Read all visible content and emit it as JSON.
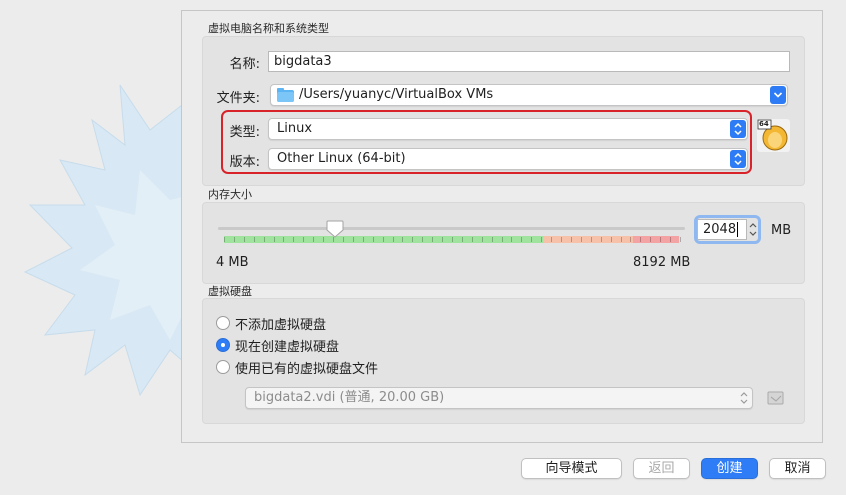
{
  "name_type_group": {
    "title": "虚拟电脑名称和系统类型",
    "name_label": "名称:",
    "name_value": "bigdata3",
    "folder_label": "文件夹:",
    "folder_value": "/Users/yuanyc/VirtualBox VMs",
    "type_label": "类型:",
    "type_value": "Linux",
    "version_label": "版本:",
    "version_value": "Other Linux (64-bit)",
    "os_icon_badge": "64",
    "os_icon": "linux-penguin-icon"
  },
  "memory_group": {
    "title": "内存大小",
    "value": "2048",
    "unit": "MB",
    "min_label": "4 MB",
    "max_label": "8192 MB",
    "slider_fraction": 0.25
  },
  "disk_group": {
    "title": "虚拟硬盘",
    "options": [
      {
        "label": "不添加虚拟硬盘",
        "checked": false
      },
      {
        "label": "现在创建虚拟硬盘",
        "checked": true
      },
      {
        "label": "使用已有的虚拟硬盘文件",
        "checked": false
      }
    ],
    "existing_file_value": "bigdata2.vdi (普通, 20.00 GB)"
  },
  "buttons": {
    "guided_mode": "向导模式",
    "back": "返回",
    "create": "创建",
    "cancel": "取消"
  },
  "colors": {
    "accent": "#2f7df6",
    "highlight_box": "#d9232a",
    "slider_green": "#9fe39f",
    "slider_orange": "#f7c0a8",
    "slider_red": "#f3a3a3"
  }
}
